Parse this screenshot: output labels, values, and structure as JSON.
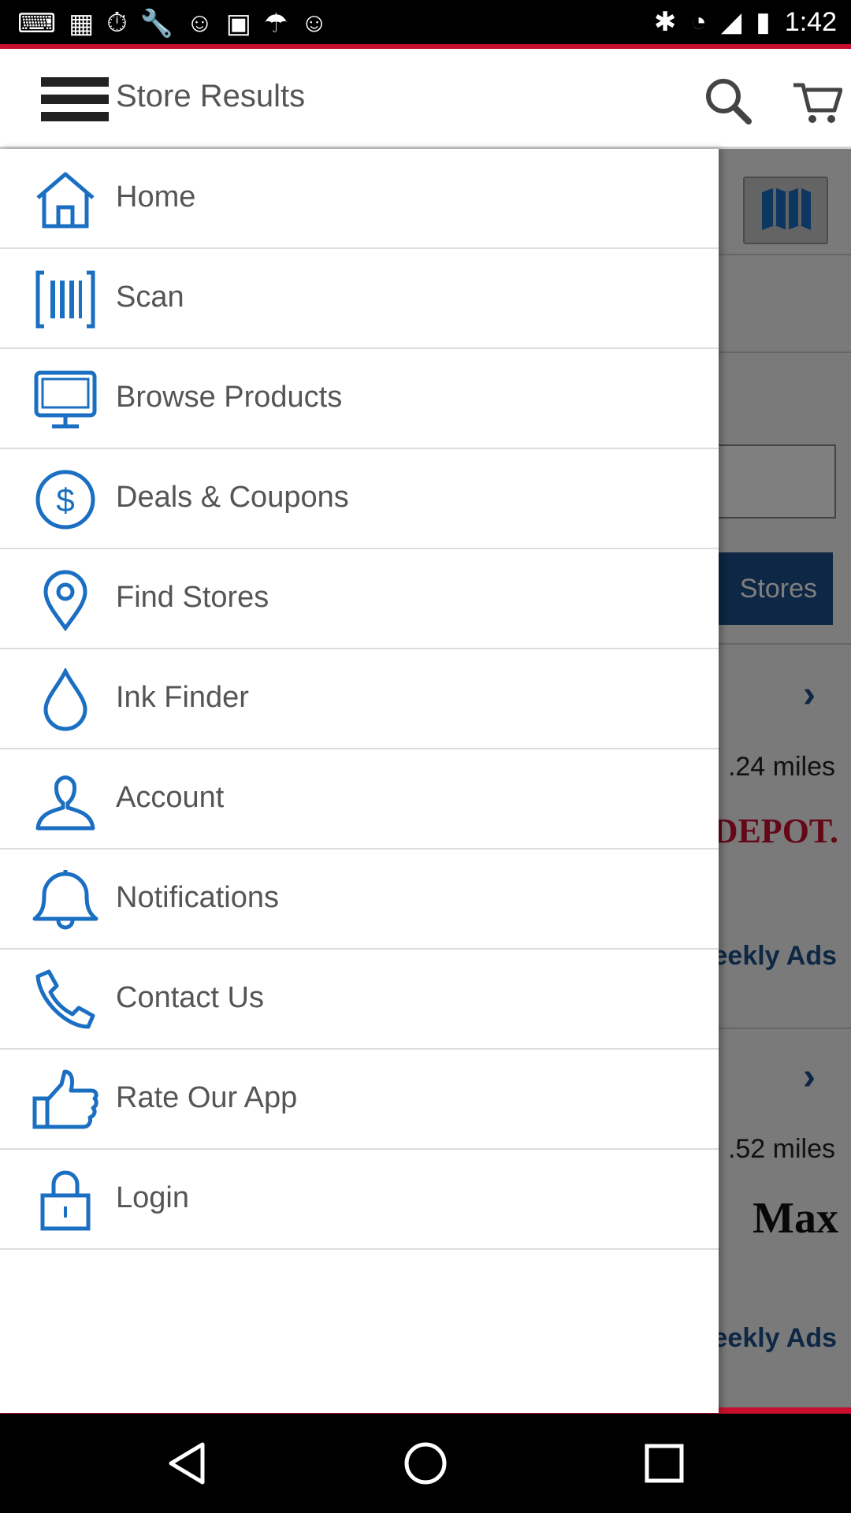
{
  "app_bar": {
    "title": "Store Results"
  },
  "status_bar": {
    "time": "1:42"
  },
  "drawer": {
    "items": [
      {
        "label": "Home",
        "icon": "home-icon"
      },
      {
        "label": "Scan",
        "icon": "barcode-icon"
      },
      {
        "label": "Browse Products",
        "icon": "monitor-icon"
      },
      {
        "label": "Deals & Coupons",
        "icon": "dollar-icon"
      },
      {
        "label": "Find Stores",
        "icon": "location-pin-icon"
      },
      {
        "label": "Ink Finder",
        "icon": "ink-drop-icon"
      },
      {
        "label": "Account",
        "icon": "user-icon"
      },
      {
        "label": "Notifications",
        "icon": "bell-icon"
      },
      {
        "label": "Contact Us",
        "icon": "phone-icon"
      },
      {
        "label": "Rate Our App",
        "icon": "thumbs-up-icon"
      },
      {
        "label": "Login",
        "icon": "lock-icon"
      }
    ]
  },
  "background": {
    "stores_button": "Stores",
    "results": [
      {
        "distance": ".24 miles",
        "brand": "DEPOT.",
        "weekly_ads": "eekly Ads"
      },
      {
        "distance": ".52 miles",
        "brand": "Max",
        "weekly_ads": "eekly Ads"
      }
    ]
  },
  "colors": {
    "accent_blue": "#1b6fc2",
    "brand_red": "#c8102e",
    "button_blue": "#1b4f8a"
  }
}
